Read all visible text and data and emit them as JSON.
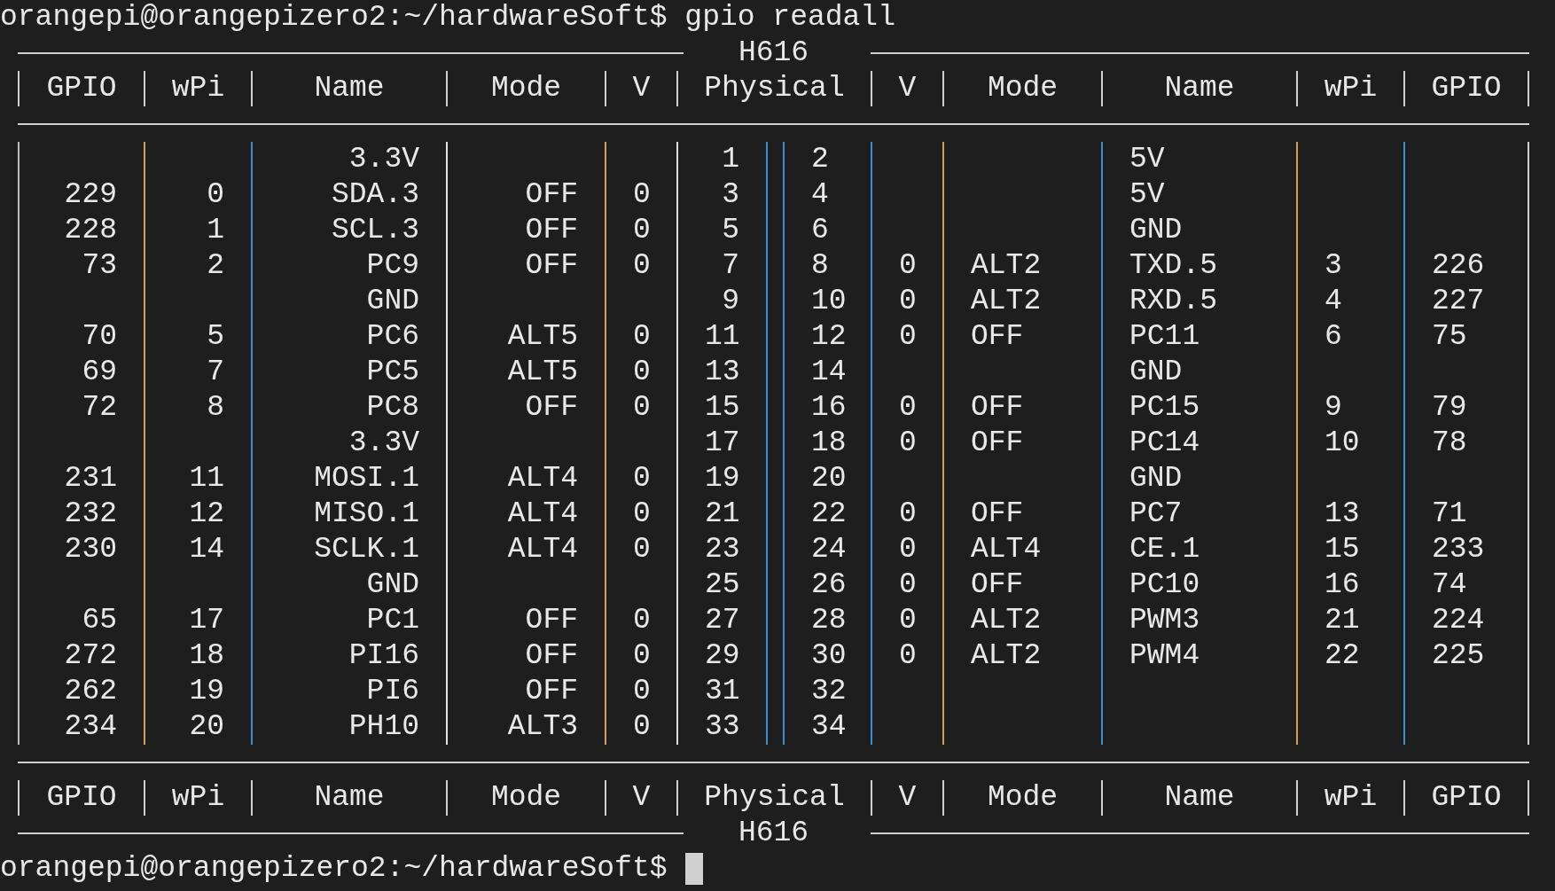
{
  "command_line": "orangepi@orangepizero2:~/hardwareSoft$ gpio readall",
  "top_label": "H616",
  "header": [
    "GPIO",
    "wPi",
    "Name",
    "Mode",
    "V",
    "Physical",
    "V",
    "Mode",
    "Name",
    "wPi",
    "GPIO"
  ],
  "rows": [
    {
      "left": {
        "name": "3.3V"
      },
      "physical": [
        "1",
        "2"
      ],
      "right": {
        "name": "5V"
      }
    },
    {
      "left": {
        "gpio": "229",
        "wpi": "0",
        "name": "SDA.3",
        "mode": "OFF",
        "v": "0"
      },
      "physical": [
        "3",
        "4"
      ],
      "right": {
        "name": "5V"
      }
    },
    {
      "left": {
        "gpio": "228",
        "wpi": "1",
        "name": "SCL.3",
        "mode": "OFF",
        "v": "0"
      },
      "physical": [
        "5",
        "6"
      ],
      "right": {
        "name": "GND"
      }
    },
    {
      "left": {
        "gpio": "73",
        "wpi": "2",
        "name": "PC9",
        "mode": "OFF",
        "v": "0"
      },
      "physical": [
        "7",
        "8"
      ],
      "right": {
        "v": "0",
        "mode": "ALT2",
        "name": "TXD.5",
        "wpi": "3",
        "gpio": "226"
      }
    },
    {
      "left": {
        "name": "GND"
      },
      "physical": [
        "9",
        "10"
      ],
      "right": {
        "v": "0",
        "mode": "ALT2",
        "name": "RXD.5",
        "wpi": "4",
        "gpio": "227"
      }
    },
    {
      "left": {
        "gpio": "70",
        "wpi": "5",
        "name": "PC6",
        "mode": "ALT5",
        "v": "0"
      },
      "physical": [
        "11",
        "12"
      ],
      "right": {
        "v": "0",
        "mode": "OFF",
        "name": "PC11",
        "wpi": "6",
        "gpio": "75"
      }
    },
    {
      "left": {
        "gpio": "69",
        "wpi": "7",
        "name": "PC5",
        "mode": "ALT5",
        "v": "0"
      },
      "physical": [
        "13",
        "14"
      ],
      "right": {
        "name": "GND"
      }
    },
    {
      "left": {
        "gpio": "72",
        "wpi": "8",
        "name": "PC8",
        "mode": "OFF",
        "v": "0"
      },
      "physical": [
        "15",
        "16"
      ],
      "right": {
        "v": "0",
        "mode": "OFF",
        "name": "PC15",
        "wpi": "9",
        "gpio": "79"
      }
    },
    {
      "left": {
        "name": "3.3V"
      },
      "physical": [
        "17",
        "18"
      ],
      "right": {
        "v": "0",
        "mode": "OFF",
        "name": "PC14",
        "wpi": "10",
        "gpio": "78"
      }
    },
    {
      "left": {
        "gpio": "231",
        "wpi": "11",
        "name": "MOSI.1",
        "mode": "ALT4",
        "v": "0"
      },
      "physical": [
        "19",
        "20"
      ],
      "right": {
        "name": "GND"
      }
    },
    {
      "left": {
        "gpio": "232",
        "wpi": "12",
        "name": "MISO.1",
        "mode": "ALT4",
        "v": "0"
      },
      "physical": [
        "21",
        "22"
      ],
      "right": {
        "v": "0",
        "mode": "OFF",
        "name": "PC7",
        "wpi": "13",
        "gpio": "71"
      }
    },
    {
      "left": {
        "gpio": "230",
        "wpi": "14",
        "name": "SCLK.1",
        "mode": "ALT4",
        "v": "0"
      },
      "physical": [
        "23",
        "24"
      ],
      "right": {
        "v": "0",
        "mode": "ALT4",
        "name": "CE.1",
        "wpi": "15",
        "gpio": "233"
      }
    },
    {
      "left": {
        "name": "GND"
      },
      "physical": [
        "25",
        "26"
      ],
      "right": {
        "v": "0",
        "mode": "OFF",
        "name": "PC10",
        "wpi": "16",
        "gpio": "74"
      }
    },
    {
      "left": {
        "gpio": "65",
        "wpi": "17",
        "name": "PC1",
        "mode": "OFF",
        "v": "0"
      },
      "physical": [
        "27",
        "28"
      ],
      "right": {
        "v": "0",
        "mode": "ALT2",
        "name": "PWM3",
        "wpi": "21",
        "gpio": "224"
      }
    },
    {
      "left": {
        "gpio": "272",
        "wpi": "18",
        "name": "PI16",
        "mode": "OFF",
        "v": "0"
      },
      "physical": [
        "29",
        "30"
      ],
      "right": {
        "v": "0",
        "mode": "ALT2",
        "name": "PWM4",
        "wpi": "22",
        "gpio": "225"
      }
    },
    {
      "left": {
        "gpio": "262",
        "wpi": "19",
        "name": "PI6",
        "mode": "OFF",
        "v": "0"
      },
      "physical": [
        "31",
        "32"
      ]
    },
    {
      "left": {
        "gpio": "234",
        "wpi": "20",
        "name": "PH10",
        "mode": "ALT3",
        "v": "0"
      },
      "physical": [
        "33",
        "34"
      ]
    }
  ],
  "footer": [
    "GPIO",
    "wPi",
    "Name",
    "Mode",
    "V",
    "Physical",
    "V",
    "Mode",
    "Name",
    "wPi",
    "GPIO"
  ],
  "bottom_label": "H616",
  "prompt": "orangepi@orangepizero2:~/hardwareSoft$"
}
